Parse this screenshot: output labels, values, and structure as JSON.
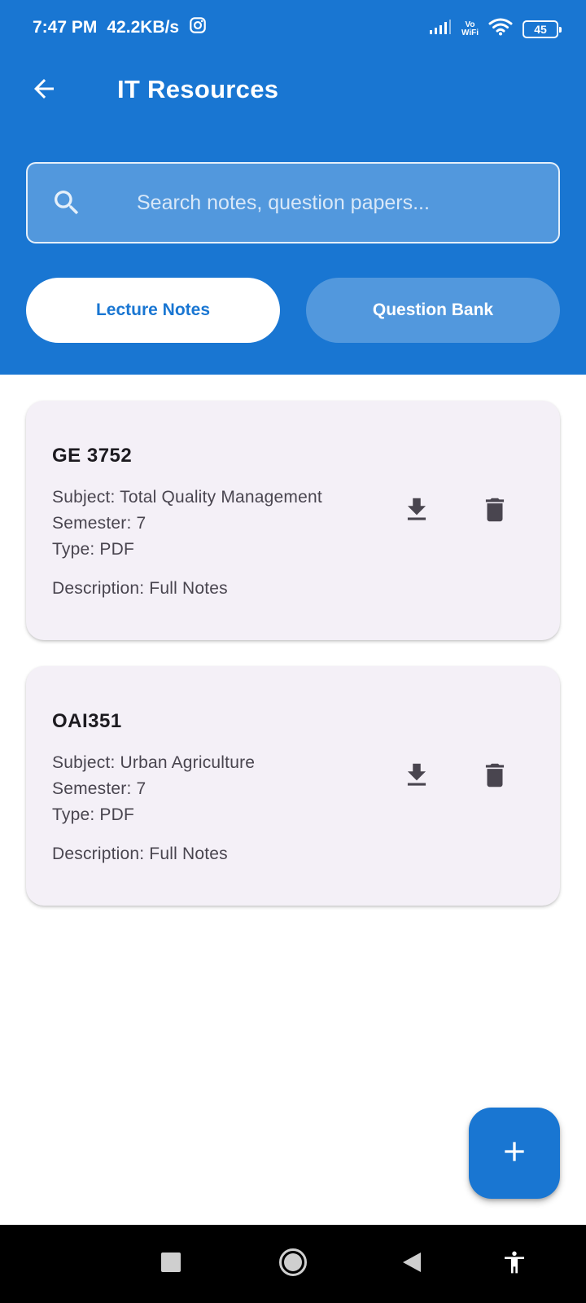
{
  "status_bar": {
    "time": "7:47 PM",
    "network_speed": "42.2KB/s",
    "vowifi_top": "Vo",
    "vowifi_bottom": "WiFi",
    "battery": "45"
  },
  "app_bar": {
    "title": "IT Resources",
    "back_icon": "arrow-back-icon"
  },
  "search": {
    "placeholder": "Search notes, question papers...",
    "value": ""
  },
  "tabs": [
    {
      "label": "Lecture Notes",
      "selected": true
    },
    {
      "label": "Question Bank",
      "selected": false
    }
  ],
  "resources": [
    {
      "code": "GE 3752",
      "subject": "Subject: Total Quality Management",
      "semester": "Semester: 7",
      "type": "Type: PDF",
      "description": "Description: Full Notes"
    },
    {
      "code": "OAI351",
      "subject": "Subject: Urban Agriculture",
      "semester": "Semester: 7",
      "type": "Type: PDF",
      "description": "Description: Full Notes"
    }
  ],
  "icons": {
    "download": "download-icon",
    "delete": "delete-icon",
    "add": "add-icon",
    "search": "search-icon"
  },
  "colors": {
    "primary": "#1976d2",
    "card_background": "#f4f0f7",
    "icon_dark": "#49454f"
  }
}
